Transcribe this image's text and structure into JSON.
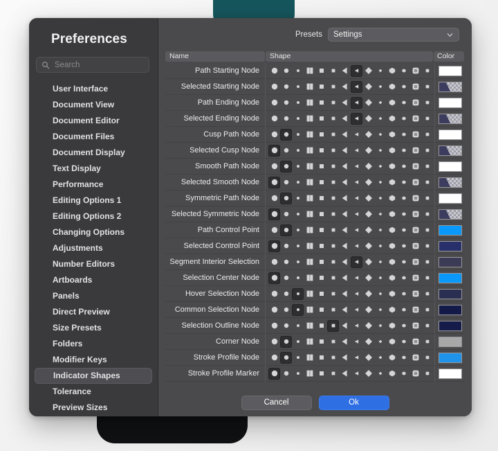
{
  "window": {
    "title": "Preferences"
  },
  "sidebar": {
    "search": {
      "placeholder": "Search",
      "value": "",
      "icon": "search-icon"
    },
    "items": [
      {
        "label": "User Interface",
        "selected": false
      },
      {
        "label": "Document View",
        "selected": false
      },
      {
        "label": "Document Editor",
        "selected": false
      },
      {
        "label": "Document Files",
        "selected": false
      },
      {
        "label": "Document Display",
        "selected": false
      },
      {
        "label": "Text Display",
        "selected": false
      },
      {
        "label": "Performance",
        "selected": false
      },
      {
        "label": "Editing Options 1",
        "selected": false
      },
      {
        "label": "Editing Options 2",
        "selected": false
      },
      {
        "label": "Changing Options",
        "selected": false
      },
      {
        "label": "Adjustments",
        "selected": false
      },
      {
        "label": "Number Editors",
        "selected": false
      },
      {
        "label": "Artboards",
        "selected": false
      },
      {
        "label": "Panels",
        "selected": false
      },
      {
        "label": "Direct Preview",
        "selected": false
      },
      {
        "label": "Size Presets",
        "selected": false
      },
      {
        "label": "Folders",
        "selected": false
      },
      {
        "label": "Modifier Keys",
        "selected": false
      },
      {
        "label": "Indicator Shapes",
        "selected": true
      },
      {
        "label": "Tolerance",
        "selected": false
      },
      {
        "label": "Preview Sizes",
        "selected": false
      }
    ]
  },
  "presets": {
    "label": "Presets",
    "selected": "Settings",
    "options": [
      "Settings"
    ],
    "chevron_icon": "chevron-down-icon"
  },
  "table": {
    "columns": [
      "Name",
      "Shape",
      "Color"
    ],
    "shape_glyphs": [
      "circle-large",
      "circle-medium",
      "circle-small",
      "square-large",
      "square-medium",
      "square-small",
      "triangle-large",
      "triangle-small",
      "diamond-large",
      "diamond-small",
      "hexagon-large",
      "hexagon-small",
      "rounded-square-large",
      "rounded-square-small"
    ],
    "rows": [
      {
        "name": "Path Starting Node",
        "shape_index": 7,
        "color": "#ffffff",
        "swatch": "solid"
      },
      {
        "name": "Selected Starting Node",
        "shape_index": 7,
        "color": "#3c3c5e",
        "swatch": "checker"
      },
      {
        "name": "Path Ending Node",
        "shape_index": 7,
        "color": "#ffffff",
        "swatch": "solid"
      },
      {
        "name": "Selected Ending Node",
        "shape_index": 7,
        "color": "#3c3c5e",
        "swatch": "checker"
      },
      {
        "name": "Cusp Path Node",
        "shape_index": 1,
        "color": "#ffffff",
        "swatch": "solid"
      },
      {
        "name": "Selected Cusp Node",
        "shape_index": 0,
        "color": "#3c3c5e",
        "swatch": "checker"
      },
      {
        "name": "Smooth Path Node",
        "shape_index": 1,
        "color": "#ffffff",
        "swatch": "solid"
      },
      {
        "name": "Selected Smooth Node",
        "shape_index": 0,
        "color": "#3c3c5e",
        "swatch": "checker"
      },
      {
        "name": "Symmetric Path Node",
        "shape_index": 1,
        "color": "#ffffff",
        "swatch": "solid"
      },
      {
        "name": "Selected Symmetric Node",
        "shape_index": 0,
        "color": "#3c3c5e",
        "swatch": "checker"
      },
      {
        "name": "Path Control Point",
        "shape_index": 1,
        "color": "#0a98fa",
        "swatch": "solid"
      },
      {
        "name": "Selected Control Point",
        "shape_index": 0,
        "color": "#27306b",
        "swatch": "solid"
      },
      {
        "name": "Segment Interior Selection",
        "shape_index": 7,
        "color": "#3b3b55",
        "swatch": "solid"
      },
      {
        "name": "Selection Center Node",
        "shape_index": 0,
        "color": "#0a98fa",
        "swatch": "solid"
      },
      {
        "name": "Hover Selection Node",
        "shape_index": 2,
        "color": "#2a2f52",
        "swatch": "solid"
      },
      {
        "name": "Common Selection Node",
        "shape_index": 2,
        "color": "#131a47",
        "swatch": "solid"
      },
      {
        "name": "Selection Outline Node",
        "shape_index": 5,
        "color": "#151c49",
        "swatch": "solid"
      },
      {
        "name": "Corner Node",
        "shape_index": 1,
        "color": "#a8a8a8",
        "swatch": "solid"
      },
      {
        "name": "Stroke Profile Node",
        "shape_index": 1,
        "color": "#1f92ea",
        "swatch": "solid"
      },
      {
        "name": "Stroke Profile Marker",
        "shape_index": 0,
        "color": "#ffffff",
        "swatch": "solid"
      }
    ]
  },
  "footer": {
    "cancel_label": "Cancel",
    "ok_label": "Ok"
  },
  "colors": {
    "accent": "#2f6fe4",
    "window_bg": "#3a3a3c",
    "pane_bg": "#4a4a4c",
    "selection": "#4e4e52"
  }
}
